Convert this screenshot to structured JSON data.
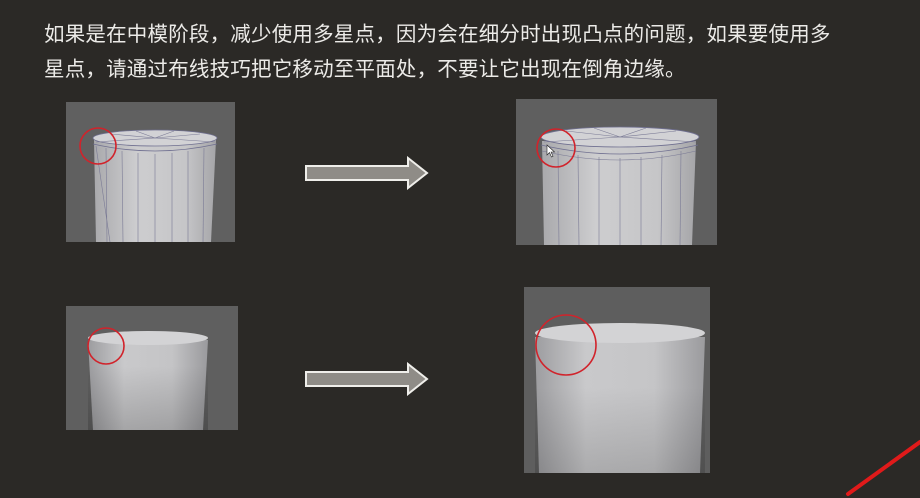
{
  "caption": {
    "line1": "如果是在中模阶段，减少使用多星点，因为会在细分时出现凸点的问题，如果要使用多",
    "line2": "星点，请通过布线技巧把它移动至平面处，不要让它出现在倒角边缘。"
  },
  "colors": {
    "background": "#2b2926",
    "text": "#ecebe8",
    "panel_bg": "#616161",
    "mesh_body": "#c3c3c5",
    "wire": "#6f6f90",
    "highlight_circle": "#d1232b",
    "arrow_fill": "#8f8c87",
    "arrow_outline": "#efeeea",
    "pen_stroke": "#e01a1a"
  },
  "icons": {
    "cursor": "mouse-pointer-icon",
    "arrows": "right-arrow-icon"
  }
}
